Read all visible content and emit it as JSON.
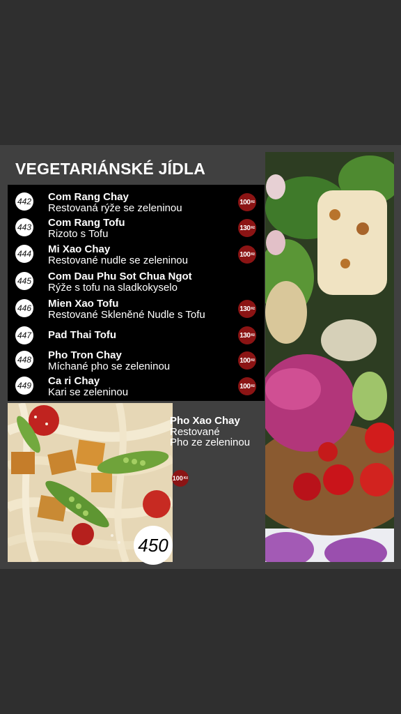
{
  "menu": {
    "title": "VEGETARIÁNSKÉ JÍDLA",
    "currency": "Kč",
    "items": [
      {
        "number": "442",
        "name": "Com Rang Chay",
        "desc": "Restovaná rýže se zeleninou",
        "price": "100"
      },
      {
        "number": "443",
        "name": "Com Rang Tofu",
        "desc": "Rizoto s Tofu",
        "price": "130"
      },
      {
        "number": "444",
        "name": "Mi Xao Chay",
        "desc": "Restované nudle se zeleninou",
        "price": "100"
      },
      {
        "number": "445",
        "name": "Com Dau Phu Sot Chua Ngot",
        "desc": "Rýže s tofu na sladkokyselo",
        "price": ""
      },
      {
        "number": "446",
        "name": "Mien Xao Tofu",
        "desc": "Restované Skleněné Nudle s Tofu",
        "price": "130"
      },
      {
        "number": "447",
        "name": "Pad Thai Tofu",
        "desc": "",
        "price": "130"
      },
      {
        "number": "448",
        "name": "Pho Tron Chay",
        "desc": "Míchané pho se zeleninou",
        "price": "100"
      },
      {
        "number": "449",
        "name": "Ca ri Chay",
        "desc": "Kari se zeleninou",
        "price": "100"
      }
    ],
    "featured": {
      "number": "450",
      "name": "Pho Xao Chay",
      "desc_line1": "Restované",
      "desc_line2": "Pho ze zeleninou",
      "price": "100"
    }
  },
  "colors": {
    "background": "#2f2f2f",
    "panel": "#404040",
    "list": "#000000",
    "price_badge": "#8b1414"
  }
}
